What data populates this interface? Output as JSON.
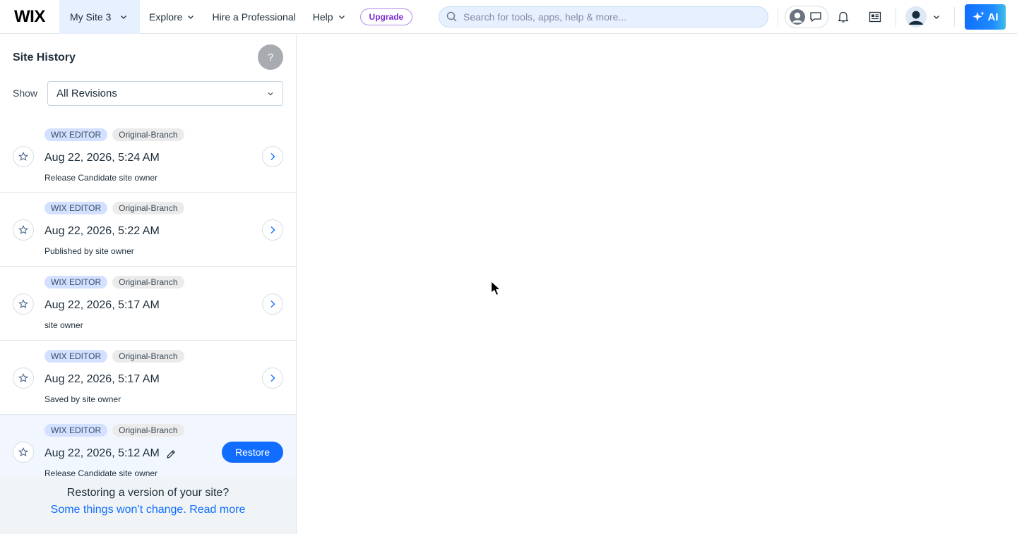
{
  "header": {
    "logo": "WIX",
    "site_name": "My Site 3",
    "nav": {
      "explore": "Explore",
      "hire": "Hire a Professional",
      "help": "Help"
    },
    "upgrade_label": "Upgrade",
    "search_placeholder": "Search for tools, apps, help & more...",
    "ai_label": "AI"
  },
  "sidebar": {
    "title": "Site History",
    "help_label": "?",
    "show_label": "Show",
    "filter_value": "All Revisions",
    "revisions": [
      {
        "badge_editor": "WIX EDITOR",
        "badge_branch": "Original-Branch",
        "date": "Aug 22, 2026, 5:24 AM",
        "subtitle": "Release Candidate site owner"
      },
      {
        "badge_editor": "WIX EDITOR",
        "badge_branch": "Original-Branch",
        "date": "Aug 22, 2026, 5:22 AM",
        "subtitle": "Published by site owner"
      },
      {
        "badge_editor": "WIX EDITOR",
        "badge_branch": "Original-Branch",
        "date": "Aug 22, 2026, 5:17 AM",
        "subtitle": "site owner"
      },
      {
        "badge_editor": "WIX EDITOR",
        "badge_branch": "Original-Branch",
        "date": "Aug 22, 2026, 5:17 AM",
        "subtitle": "Saved by site owner"
      },
      {
        "badge_editor": "WIX EDITOR",
        "badge_branch": "Original-Branch",
        "date": "Aug 22, 2026, 5:12 AM",
        "subtitle": "Release Candidate site owner",
        "action_label": "Restore"
      }
    ],
    "footer": {
      "question": "Restoring a version of your site?",
      "link": "Some things won’t change. Read more"
    }
  },
  "colors": {
    "accent": "#116dff",
    "upgrade": "#7a2bd6",
    "selected_bg": "#e7f0ff",
    "active_row_bg": "#f2f7ff"
  },
  "icons": [
    "chevron-down-icon",
    "search-icon",
    "help-center-icon",
    "chat-icon",
    "bell-icon",
    "news-icon",
    "avatar-icon",
    "sparkle-icon",
    "star-icon",
    "chevron-right-icon",
    "pencil-icon",
    "mouse-cursor-icon"
  ]
}
